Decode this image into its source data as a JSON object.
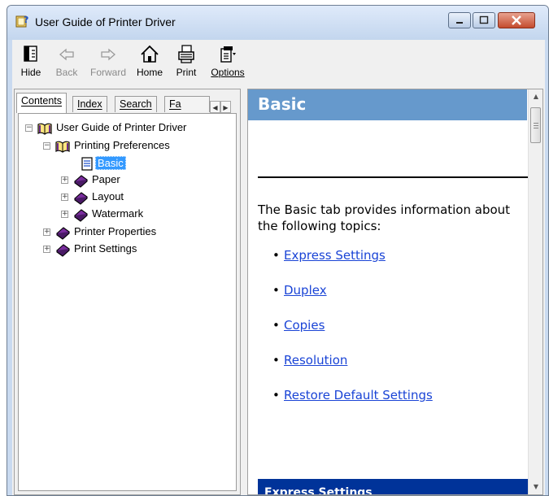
{
  "window": {
    "title": "User Guide of Printer Driver",
    "controls": {
      "minimize": "minimize",
      "maximize": "maximize",
      "close": "close"
    }
  },
  "toolbar": {
    "buttons": [
      {
        "label": "Hide",
        "icon": "hide-icon",
        "enabled": true
      },
      {
        "label": "Back",
        "icon": "back-arrow-icon",
        "enabled": false
      },
      {
        "label": "Forward",
        "icon": "forward-arrow-icon",
        "enabled": false
      },
      {
        "label": "Home",
        "icon": "home-icon",
        "enabled": true
      },
      {
        "label": "Print",
        "icon": "printer-icon",
        "enabled": true
      },
      {
        "label": "Options",
        "icon": "options-icon",
        "enabled": true
      }
    ]
  },
  "nav": {
    "tabs": [
      {
        "label": "Contents",
        "active": true
      },
      {
        "label": "Index",
        "active": false
      },
      {
        "label": "Search",
        "active": false
      },
      {
        "label": "Fa",
        "active": false
      }
    ],
    "tree": [
      {
        "label": "User Guide of Printer Driver",
        "level": 0,
        "expander": "-",
        "icon": "open-book-icon",
        "selected": false
      },
      {
        "label": "Printing Preferences",
        "level": 1,
        "expander": "-",
        "icon": "open-book-icon",
        "selected": false
      },
      {
        "label": "Basic",
        "level": 2,
        "expander": "",
        "icon": "page-icon",
        "selected": true
      },
      {
        "label": "Paper",
        "level": 2,
        "expander": "+",
        "icon": "closed-book-icon",
        "selected": false
      },
      {
        "label": "Layout",
        "level": 2,
        "expander": "+",
        "icon": "closed-book-icon",
        "selected": false
      },
      {
        "label": "Watermark",
        "level": 2,
        "expander": "+",
        "icon": "closed-book-icon",
        "selected": false
      },
      {
        "label": "Printer Properties",
        "level": 1,
        "expander": "+",
        "icon": "closed-book-icon",
        "selected": false
      },
      {
        "label": "Print Settings",
        "level": 1,
        "expander": "+",
        "icon": "closed-book-icon",
        "selected": false
      }
    ]
  },
  "content": {
    "heading": "Basic",
    "intro": "The Basic tab provides information about the following topics:",
    "topics": [
      "Express Settings",
      "Duplex",
      "Copies",
      "Resolution",
      "Restore Default Settings"
    ],
    "section_title": "Express Settings"
  },
  "colors": {
    "header_bg": "#6699cc",
    "section_bg": "#003399",
    "link": "#1a44d6",
    "selection": "#3399ff"
  }
}
